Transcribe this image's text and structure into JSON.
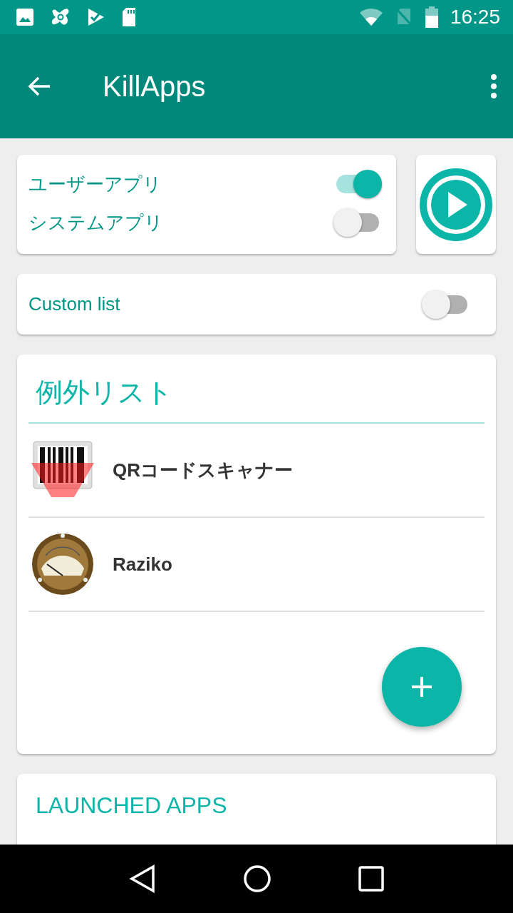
{
  "status_bar": {
    "time": "16:25"
  },
  "app_bar": {
    "title": "KillApps"
  },
  "filters": [
    {
      "label": "ユーザーアプリ",
      "on": true
    },
    {
      "label": "システムアプリ",
      "on": false
    }
  ],
  "custom_list": {
    "label": "Custom list",
    "on": false
  },
  "exception_list": {
    "title": "例外リスト",
    "apps": [
      {
        "name": "QRコードスキャナー",
        "kind": "barcode"
      },
      {
        "name": "Raziko",
        "kind": "meter"
      }
    ]
  },
  "launched_apps": {
    "title": "LAUNCHED APPS"
  }
}
